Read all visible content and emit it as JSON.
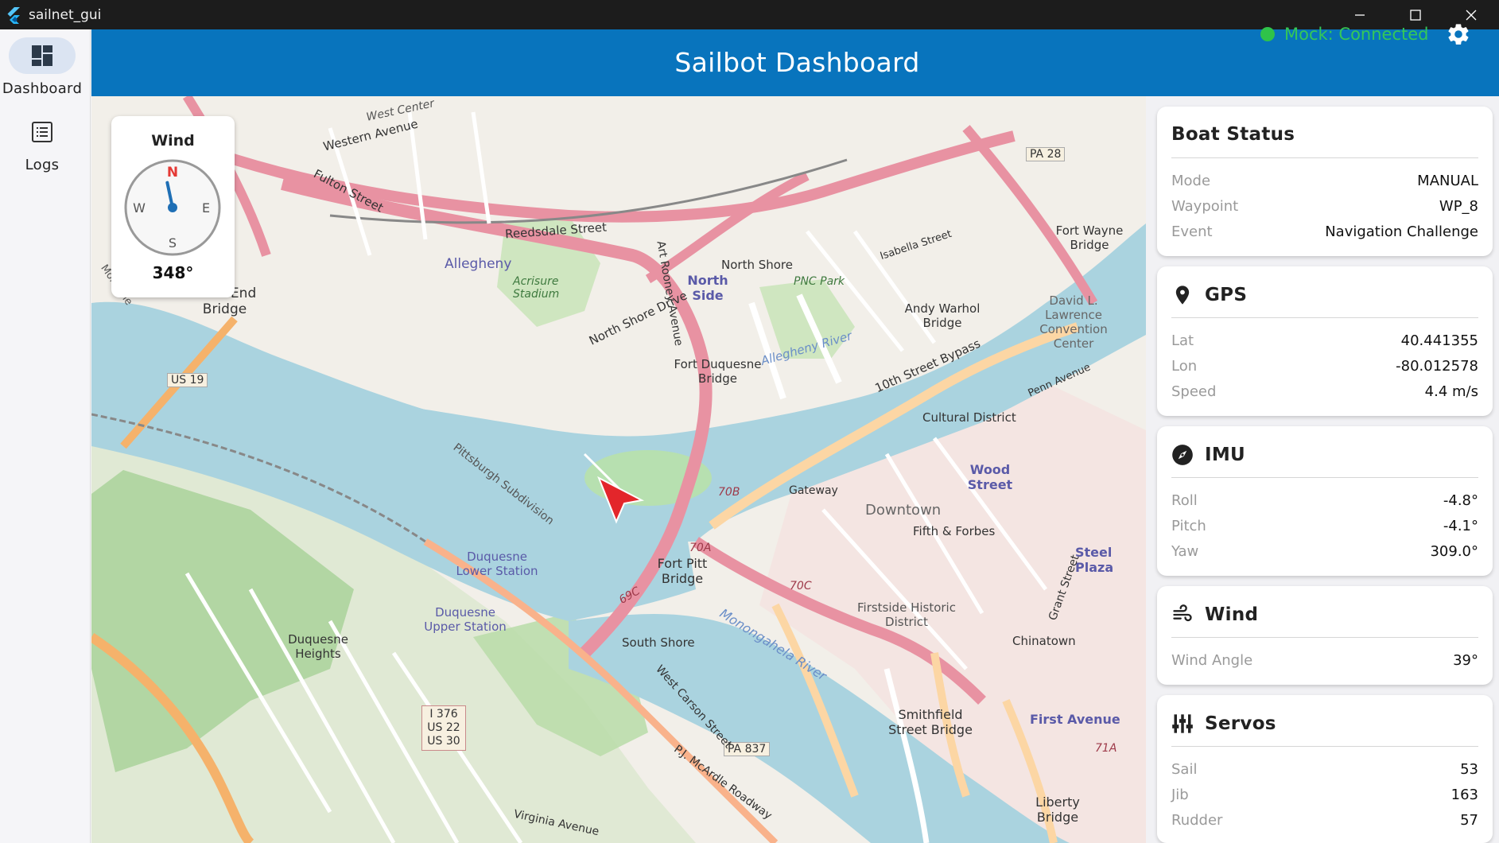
{
  "window": {
    "title": "sailnet_gui"
  },
  "nav": [
    {
      "label": "Dashboard",
      "icon": "dashboard-icon",
      "active": true
    },
    {
      "label": "Logs",
      "icon": "list-icon",
      "active": false
    }
  ],
  "appbar": {
    "title": "Sailbot Dashboard",
    "status": "Mock: Connected",
    "status_color": "#2fc34a",
    "settings_icon": "gear-icon",
    "bar_color": "#0874bd"
  },
  "wind_compass": {
    "title": "Wind",
    "n": "N",
    "e": "E",
    "s": "S",
    "w": "W",
    "heading_deg": 348,
    "value": "348°"
  },
  "map": {
    "labels": [
      "West Center",
      "Western Avenue",
      "Fulton Street",
      "Reedsdale Street",
      "Allegheny",
      "Acrisure Stadium",
      "Art Rooney Avenue",
      "North Side",
      "North Shore",
      "PNC Park",
      "Isabella Street",
      "Fort Wayne Bridge",
      "North Shore Drive",
      "Andy Warhol Bridge",
      "David L. Lawrence Convention Center",
      "Fort Duquesne Bridge",
      "Allegheny River",
      "10th Street Bypass",
      "Penn Avenue",
      "Cultural District",
      "West End Bridge",
      "US 19",
      "Mon Line",
      "Pittsburgh Subdivision",
      "Wood Street",
      "Gateway",
      "Downtown",
      "Fifth & Forbes",
      "Steel Plaza",
      "Duquesne Lower Station",
      "Fort Pitt Bridge",
      "Duquesne Upper Station",
      "Firstside Historic District",
      "Chinatown",
      "South Shore",
      "Monongahela River",
      "Duquesne Heights",
      "Smithfield Street Bridge",
      "First Avenue",
      "I 376 US 22 US 30",
      "PA 837",
      "West Carson Street",
      "Liberty Bridge",
      "PA 28",
      "Virginia Avenue",
      "Grant Street",
      "P.J. McArdle Roadway",
      "70B",
      "70A",
      "70C",
      "69C",
      "71A"
    ],
    "boat_icon": "boat-arrow-icon"
  },
  "boat_status": {
    "title": "Boat Status",
    "rows": [
      {
        "k": "Mode",
        "v": "MANUAL"
      },
      {
        "k": "Waypoint",
        "v": "WP_8"
      },
      {
        "k": "Event",
        "v": "Navigation Challenge"
      }
    ]
  },
  "gps": {
    "title": "GPS",
    "icon": "location-pin-icon",
    "rows": [
      {
        "k": "Lat",
        "v": "40.441355"
      },
      {
        "k": "Lon",
        "v": "-80.012578"
      },
      {
        "k": "Speed",
        "v": "4.4 m/s"
      }
    ]
  },
  "imu": {
    "title": "IMU",
    "icon": "compass-icon",
    "rows": [
      {
        "k": "Roll",
        "v": "-4.8°"
      },
      {
        "k": "Pitch",
        "v": "-4.1°"
      },
      {
        "k": "Yaw",
        "v": "309.0°"
      }
    ]
  },
  "wind": {
    "title": "Wind",
    "icon": "wind-icon",
    "rows": [
      {
        "k": "Wind Angle",
        "v": "39°"
      }
    ]
  },
  "servos": {
    "title": "Servos",
    "icon": "sliders-icon",
    "rows": [
      {
        "k": "Sail",
        "v": "53"
      },
      {
        "k": "Jib",
        "v": "163"
      },
      {
        "k": "Rudder",
        "v": "57"
      }
    ]
  }
}
